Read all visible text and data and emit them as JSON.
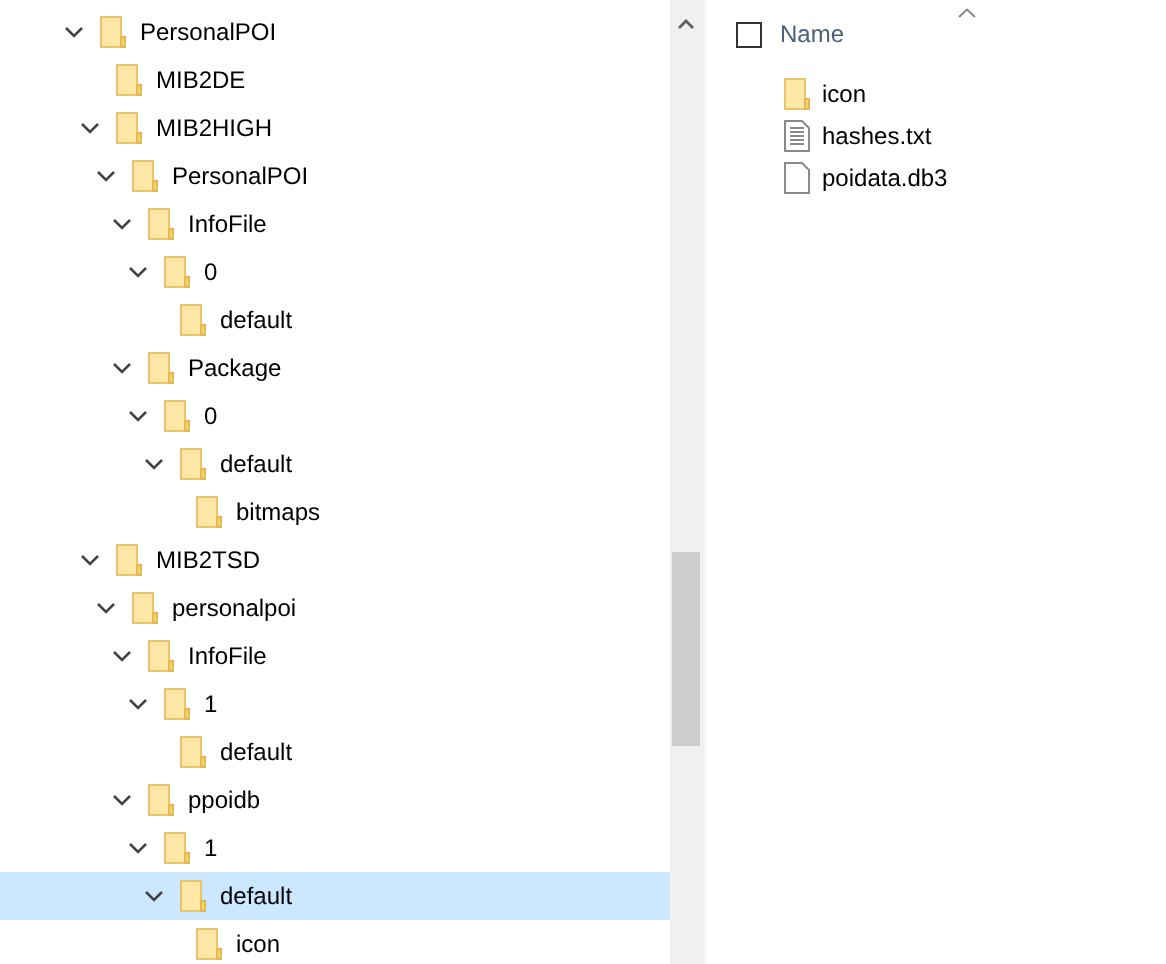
{
  "tree": [
    {
      "label": "PersonalPOI",
      "expanded": true,
      "selected": false,
      "children": [
        {
          "label": "MIB2DE",
          "selected": false
        },
        {
          "label": "MIB2HIGH",
          "expanded": true,
          "selected": false,
          "children": [
            {
              "label": "PersonalPOI",
              "expanded": true,
              "selected": false,
              "children": [
                {
                  "label": "InfoFile",
                  "expanded": true,
                  "selected": false,
                  "children": [
                    {
                      "label": "0",
                      "expanded": true,
                      "selected": false,
                      "children": [
                        {
                          "label": "default",
                          "selected": false
                        }
                      ]
                    }
                  ]
                },
                {
                  "label": "Package",
                  "expanded": true,
                  "selected": false,
                  "children": [
                    {
                      "label": "0",
                      "expanded": true,
                      "selected": false,
                      "children": [
                        {
                          "label": "default",
                          "expanded": true,
                          "selected": false,
                          "children": [
                            {
                              "label": "bitmaps",
                              "selected": false
                            }
                          ]
                        }
                      ]
                    }
                  ]
                }
              ]
            }
          ]
        },
        {
          "label": "MIB2TSD",
          "expanded": true,
          "selected": false,
          "children": [
            {
              "label": "personalpoi",
              "expanded": true,
              "selected": false,
              "children": [
                {
                  "label": "InfoFile",
                  "expanded": true,
                  "selected": false,
                  "children": [
                    {
                      "label": "1",
                      "expanded": true,
                      "selected": false,
                      "children": [
                        {
                          "label": "default",
                          "selected": false
                        }
                      ]
                    }
                  ]
                },
                {
                  "label": "ppoidb",
                  "expanded": true,
                  "selected": false,
                  "children": [
                    {
                      "label": "1",
                      "expanded": true,
                      "selected": false,
                      "children": [
                        {
                          "label": "default",
                          "expanded": true,
                          "selected": true,
                          "children": [
                            {
                              "label": "icon",
                              "selected": false
                            }
                          ]
                        }
                      ]
                    }
                  ]
                }
              ]
            }
          ]
        }
      ]
    }
  ],
  "file_list": {
    "header": {
      "label": "Name",
      "checked": false
    },
    "files": [
      {
        "name": "icon",
        "kind": "folder"
      },
      {
        "name": "hashes.txt",
        "kind": "text"
      },
      {
        "name": "poidata.db3",
        "kind": "file"
      }
    ]
  }
}
